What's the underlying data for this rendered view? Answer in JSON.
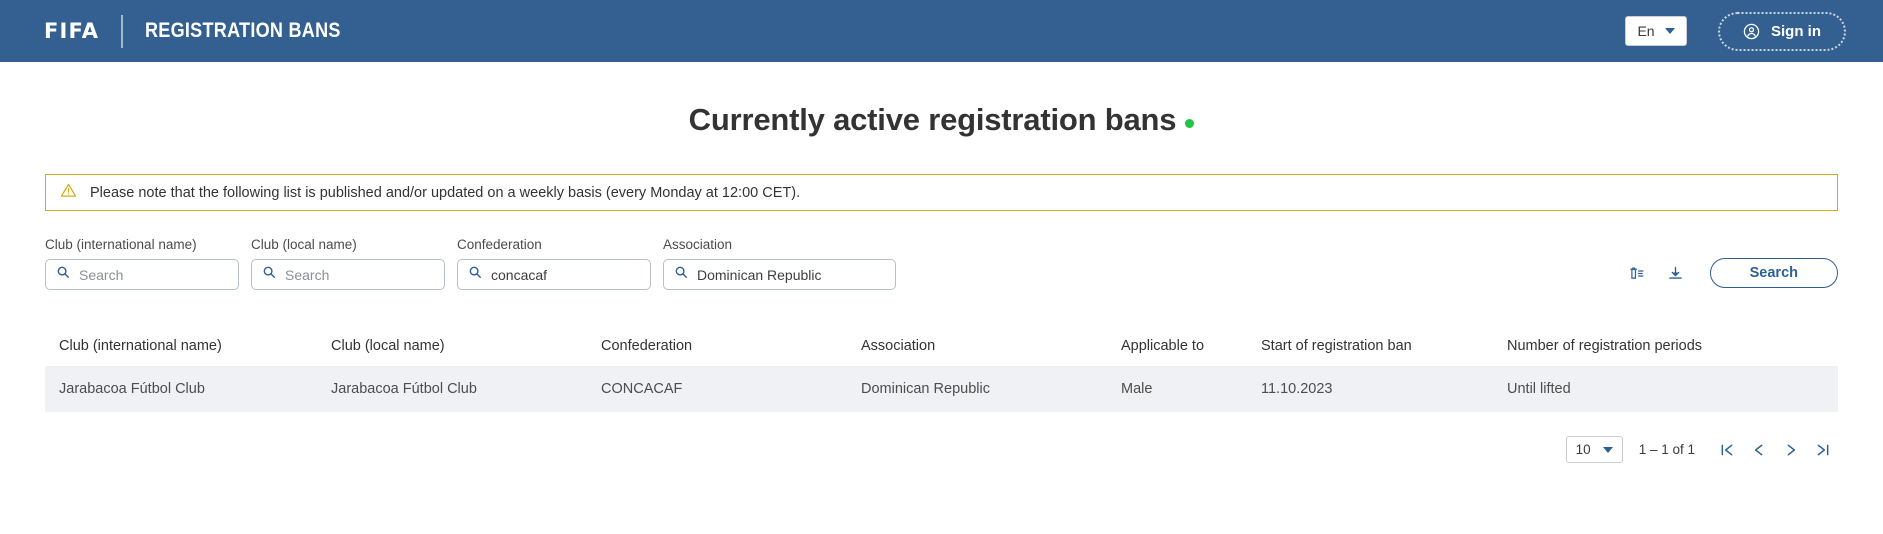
{
  "header": {
    "logo_text": "FIFA",
    "title": "REGISTRATION BANS",
    "language": "En",
    "signin_label": "Sign in"
  },
  "page": {
    "title": "Currently active registration bans"
  },
  "alert": {
    "text": "Please note that the following list is published and/or updated on a weekly basis (every Monday at 12:00 CET)."
  },
  "filters": {
    "fields": [
      {
        "label": "Club (international name)",
        "value": "",
        "placeholder": "Search"
      },
      {
        "label": "Club (local name)",
        "value": "",
        "placeholder": "Search"
      },
      {
        "label": "Confederation",
        "value": "concacaf",
        "placeholder": "Search"
      },
      {
        "label": "Association",
        "value": "Dominican Republic",
        "placeholder": "Search"
      }
    ],
    "search_button": "Search"
  },
  "table": {
    "columns": [
      "Club (international name)",
      "Club (local name)",
      "Confederation",
      "Association",
      "Applicable to",
      "Start of registration ban",
      "Number of registration periods"
    ],
    "rows": [
      {
        "club_international": "Jarabacoa Fútbol Club",
        "club_local": "Jarabacoa Fútbol Club",
        "confederation": "CONCACAF",
        "association": "Dominican Republic",
        "applicable_to": "Male",
        "start_of_ban": "11.10.2023",
        "registration_periods": "Until lifted"
      }
    ]
  },
  "pagination": {
    "page_size": "10",
    "range": "1 – 1 of 1"
  },
  "colors": {
    "header_blue": "#336091",
    "accent_blue": "#2c5f96",
    "alert_border": "#cfae1b",
    "green_dot": "#22c442",
    "row_bg": "#f0f1f5"
  }
}
